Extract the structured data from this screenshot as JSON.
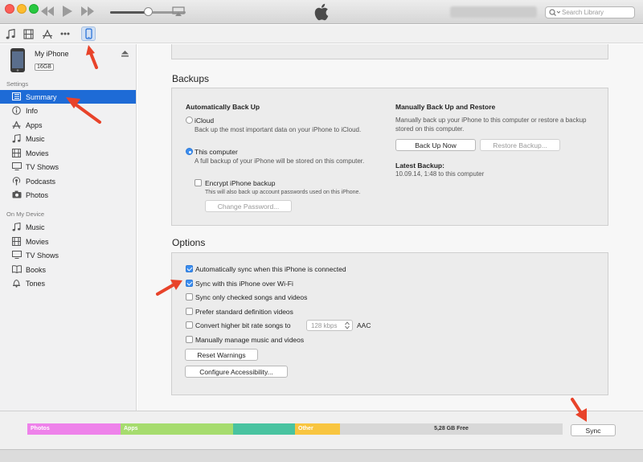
{
  "colors": {
    "selection": "#1e6bd6",
    "arrow": "#e8432a",
    "photos": "#ee82ea",
    "apps": "#a6dc6e",
    "teal": "#49c3a0",
    "other": "#f8c540",
    "free": "#d8d8d8"
  },
  "titlebar": {
    "search_placeholder": "Search Library",
    "icons": {
      "back": "rewind-icon",
      "play": "play-icon",
      "forward": "fast-forward-icon",
      "airplay": "airplay-icon",
      "logo": "apple-logo-icon"
    }
  },
  "toolbar": {
    "icons": [
      "music-note-icon",
      "film-icon",
      "app-store-icon",
      "more-icon",
      "iphone-icon"
    ]
  },
  "device": {
    "name": "My iPhone",
    "capacity": "16GB"
  },
  "sidebar": {
    "settings_header": "Settings",
    "settings": [
      {
        "label": "Summary",
        "icon": "summary-icon"
      },
      {
        "label": "Info",
        "icon": "info-icon"
      },
      {
        "label": "Apps",
        "icon": "apps-icon"
      },
      {
        "label": "Music",
        "icon": "music-icon"
      },
      {
        "label": "Movies",
        "icon": "movies-icon"
      },
      {
        "label": "TV Shows",
        "icon": "tv-icon"
      },
      {
        "label": "Podcasts",
        "icon": "podcast-icon"
      },
      {
        "label": "Photos",
        "icon": "camera-icon"
      }
    ],
    "device_header": "On My Device",
    "device_items": [
      {
        "label": "Music",
        "icon": "music-icon"
      },
      {
        "label": "Movies",
        "icon": "movies-icon"
      },
      {
        "label": "TV Shows",
        "icon": "tv-icon"
      },
      {
        "label": "Books",
        "icon": "book-icon"
      },
      {
        "label": "Tones",
        "icon": "bell-icon"
      }
    ]
  },
  "backups": {
    "title": "Backups",
    "auto_title": "Automatically Back Up",
    "icloud_label": "iCloud",
    "icloud_desc": "Back up the most important data on your iPhone to iCloud.",
    "computer_label": "This computer",
    "computer_desc": "A full backup of your iPhone will be stored on this computer.",
    "encrypt_label": "Encrypt iPhone backup",
    "encrypt_desc": "This will also back up account passwords used on this iPhone.",
    "change_password": "Change Password...",
    "manual_title": "Manually Back Up and Restore",
    "manual_desc": "Manually back up your iPhone to this computer or restore a backup stored on this computer.",
    "back_up_now": "Back Up Now",
    "restore_backup": "Restore Backup...",
    "latest_title": "Latest Backup:",
    "latest_value": "10.09.14, 1:48 to this computer"
  },
  "options": {
    "title": "Options",
    "items": [
      {
        "label": "Automatically sync when this iPhone is connected",
        "checked": true
      },
      {
        "label": "Sync with this iPhone over Wi-Fi",
        "checked": true
      },
      {
        "label": "Sync only checked songs and videos",
        "checked": false
      },
      {
        "label": "Prefer standard definition videos",
        "checked": false
      },
      {
        "label": "Convert higher bit rate songs to",
        "checked": false
      },
      {
        "label": "Manually manage music and videos",
        "checked": false
      }
    ],
    "bitrate_value": "128 kbps",
    "bitrate_format": "AAC",
    "reset_warnings": "Reset Warnings",
    "configure_accessibility": "Configure Accessibility..."
  },
  "capacity": {
    "photos": "Photos",
    "apps": "Apps",
    "other": "Other",
    "free": "5,28 GB Free",
    "sync": "Sync"
  }
}
